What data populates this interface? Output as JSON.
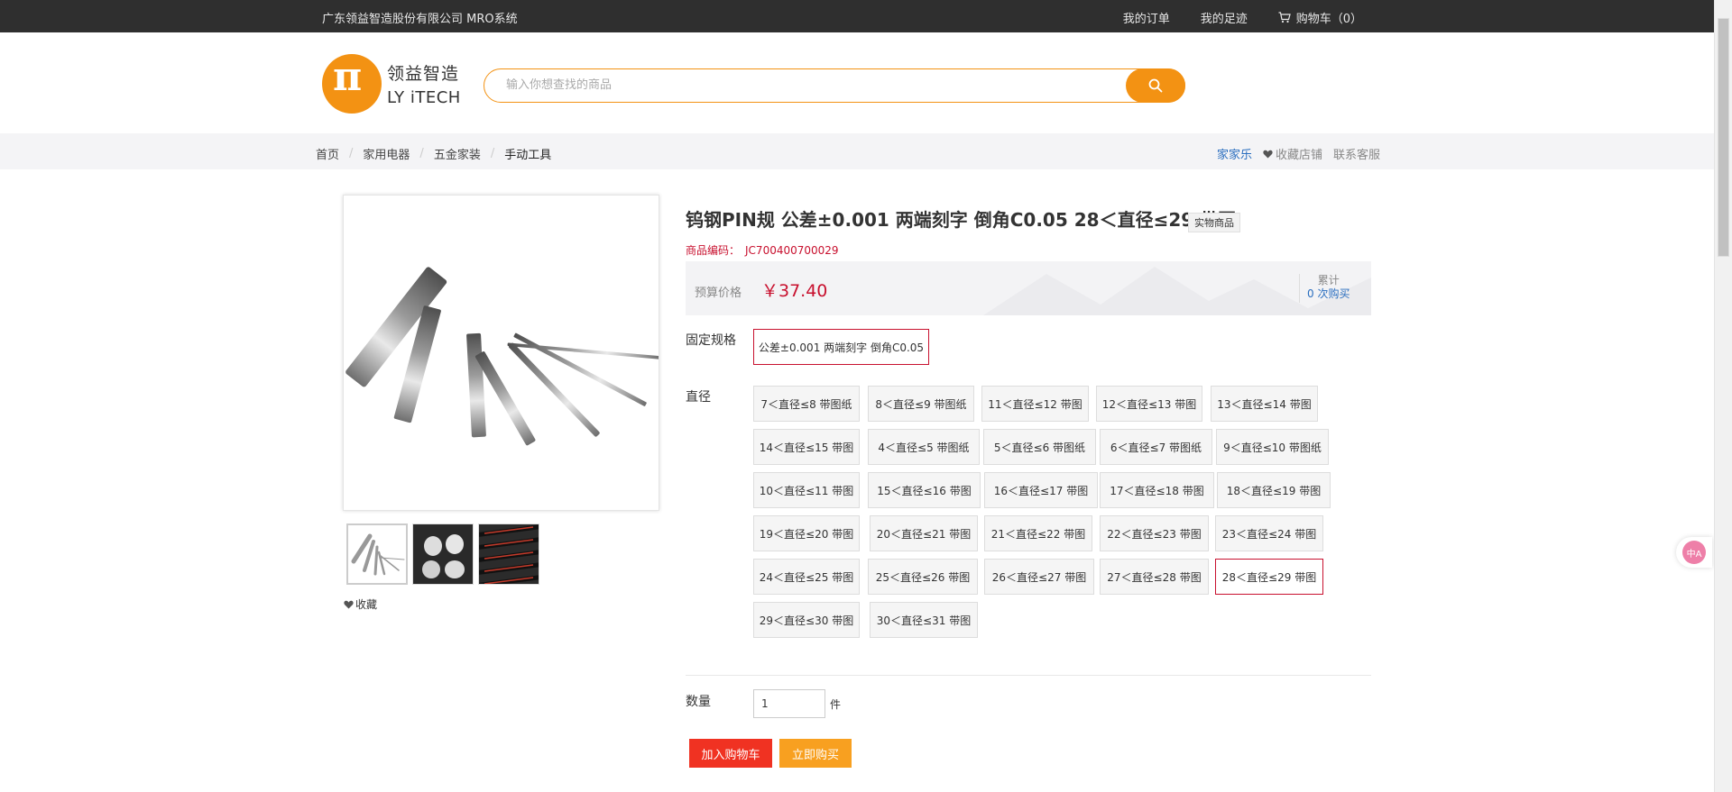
{
  "topbar": {
    "company": "广东领益智造股份有限公司 MRO系统",
    "orders": "我的订单",
    "history": "我的足迹",
    "cart": "购物车（0）"
  },
  "logo": {
    "cn": "领益智造",
    "en": "LY iTECH",
    "symbol": "π"
  },
  "search": {
    "placeholder": "输入你想查找的商品"
  },
  "breadcrumb": [
    "首页",
    "家用电器",
    "五金家装",
    "手动工具"
  ],
  "shop": {
    "name": "家家乐",
    "fav_shop": "收藏店铺",
    "contact": "联系客服"
  },
  "product": {
    "title": "钨钢PIN规 公差±0.001 两端刻字 倒角C0.05 28＜直径≤29 带图",
    "badge": "实物商品",
    "code_label": "商品编码：",
    "code": "JC700400700029",
    "price_label": "预算价格",
    "price": "￥37.40",
    "acc_label": "累计",
    "acc_value": "0 次购买",
    "fav": "收藏"
  },
  "specs": {
    "fixed_label": "固定规格",
    "fixed_option": "公差±0.001 两端刻字 倒角C0.05",
    "diameter_label": "直径",
    "diameter_options": [
      "7＜直径≤8 带图纸",
      "8＜直径≤9 带图纸",
      "11＜直径≤12 带图",
      "12＜直径≤13 带图",
      "13＜直径≤14 带图",
      "14＜直径≤15 带图",
      "4＜直径≤5 带图纸",
      "5＜直径≤6 带图纸",
      "6＜直径≤7 带图纸",
      "9＜直径≤10 带图纸",
      "10＜直径≤11 带图",
      "15＜直径≤16 带图",
      "16＜直径≤17 带图",
      "17＜直径≤18 带图",
      "18＜直径≤19 带图",
      "19＜直径≤20 带图",
      "20＜直径≤21 带图",
      "21＜直径≤22 带图",
      "22＜直径≤23 带图",
      "23＜直径≤24 带图",
      "24＜直径≤25 带图",
      "25＜直径≤26 带图",
      "26＜直径≤27 带图",
      "27＜直径≤28 带图",
      "28＜直径≤29 带图",
      "29＜直径≤30 带图",
      "30＜直径≤31 带图"
    ],
    "selected": "28＜直径≤29 带图"
  },
  "quantity": {
    "label": "数量",
    "value": "1",
    "unit": "件"
  },
  "actions": {
    "add_cart": "加入购物车",
    "buy_now": "立即购买"
  },
  "float": {
    "label": "中A"
  },
  "colors": {
    "brand": "#f39213",
    "accent_red": "#c8102e",
    "cart_red": "#f03222",
    "buy_orange": "#f8a020"
  }
}
